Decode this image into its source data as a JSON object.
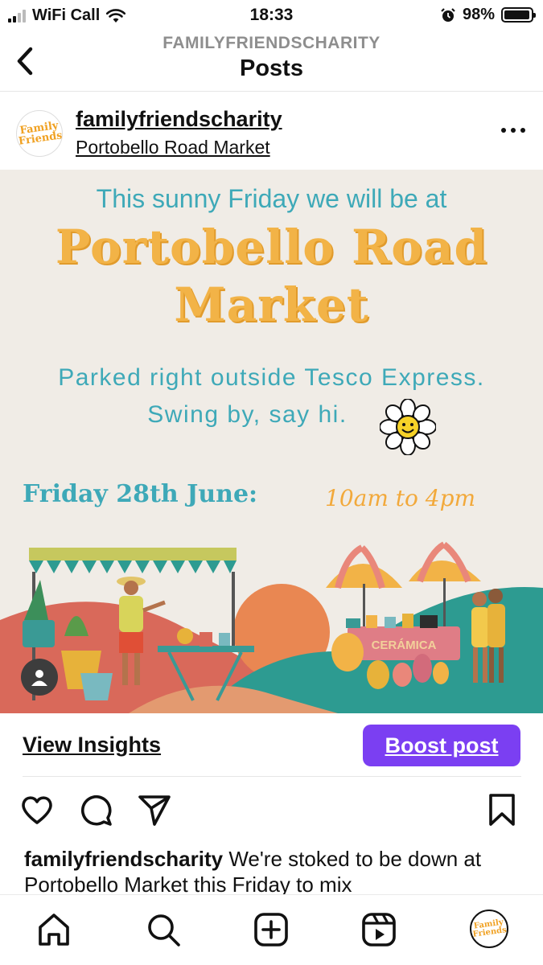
{
  "status_bar": {
    "carrier": "WiFi Call",
    "time": "18:33",
    "battery": "98%",
    "battery_level": 0.98
  },
  "header": {
    "subtitle": "FAMILYFRIENDSCHARITY",
    "title": "Posts"
  },
  "post": {
    "username": "familyfriendscharity",
    "location": "Portobello Road Market",
    "avatar_text_line1": "Family",
    "avatar_text_line2": "Friends",
    "image": {
      "line1": "This sunny Friday we will be at",
      "title_line1": "Portobello Road",
      "title_line2": "Market",
      "line2a": "Parked right outside Tesco Express.",
      "line2b": "Swing by, say hi.",
      "date": "Friday 28th June:",
      "time": "10am to 4pm",
      "stall_sign": "CERÁMICA"
    },
    "view_insights_label": "View Insights",
    "boost_label": "Boost post",
    "caption_user": "familyfriendscharity",
    "caption_text": " We're stoked to be down at Portobello Market this Friday to mix"
  },
  "icons": {
    "back": "chevron-left-icon",
    "more": "more-horizontal-icon",
    "like": "heart-icon",
    "comment": "comment-icon",
    "share": "send-icon",
    "save": "bookmark-icon",
    "home": "home-icon",
    "search": "search-icon",
    "create": "plus-square-icon",
    "reels": "reels-icon"
  },
  "colors": {
    "boost": "#7b3ff2",
    "teal": "#3ea9b8",
    "mustard": "#f2b347",
    "image_bg": "#f0ece6"
  }
}
